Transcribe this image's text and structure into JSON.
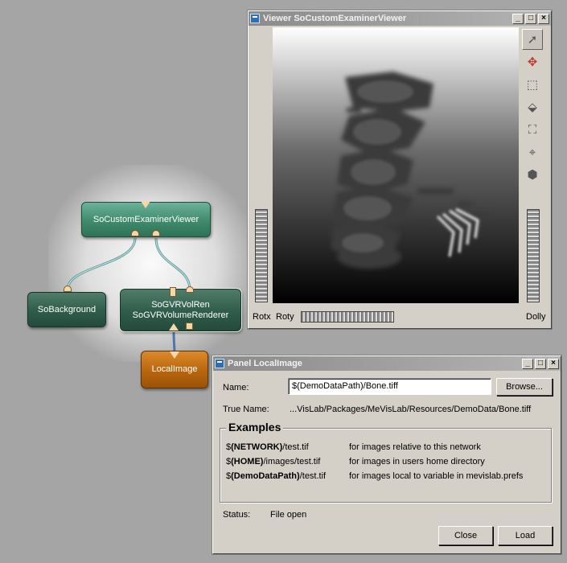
{
  "network": {
    "modules": {
      "examiner_viewer": "SoCustomExaminerViewer",
      "background": "SoBackground",
      "vol_ren_line1": "SoGVRVolRen",
      "vol_ren_line2": "SoGVRVolumeRenderer",
      "local_image": "LocalImage"
    }
  },
  "viewer": {
    "title": "Viewer SoCustomExaminerViewer",
    "buttons": {
      "minimize": "_",
      "maximize": "□",
      "close": "×"
    },
    "tools": [
      {
        "icon": "pick-arrow-icon",
        "glyph": "➚"
      },
      {
        "icon": "rotate-view-icon",
        "glyph": "✥"
      },
      {
        "icon": "home-icon",
        "glyph": "⬚"
      },
      {
        "icon": "set-home-icon",
        "glyph": "⬙"
      },
      {
        "icon": "view-all-icon",
        "glyph": "⛶"
      },
      {
        "icon": "seek-icon",
        "glyph": "⌖"
      },
      {
        "icon": "projection-icon",
        "glyph": "⬢"
      }
    ],
    "labels": {
      "rotx": "Rotx",
      "roty": "Roty",
      "dolly": "Dolly"
    }
  },
  "panel": {
    "title": "Panel LocalImage",
    "buttons": {
      "minimize": "_",
      "maximize": "□",
      "close": "×"
    },
    "name_label": "Name:",
    "name_value": "$(DemoDataPath)/Bone.tiff",
    "browse_label": "Browse...",
    "true_name_label": "True Name:",
    "true_name_value": "...VisLab/Packages/MeVisLab/Resources/DemoData/Bone.tiff",
    "examples_title": "Examples",
    "examples": [
      {
        "prefix": "$",
        "var": "(NETWORK)",
        "path": "/test.tif",
        "desc": "for images relative to this network"
      },
      {
        "prefix": "$",
        "var": "(HOME)",
        "path": "/images/test.tif",
        "desc": "for images in users home directory"
      },
      {
        "prefix": "$",
        "var": "(DemoDataPath)",
        "path": "/test.tif",
        "desc": "for images local to variable in mevislab.prefs"
      }
    ],
    "status_label": "Status:",
    "status_value": "File open",
    "close_label": "Close",
    "load_label": "Load"
  }
}
